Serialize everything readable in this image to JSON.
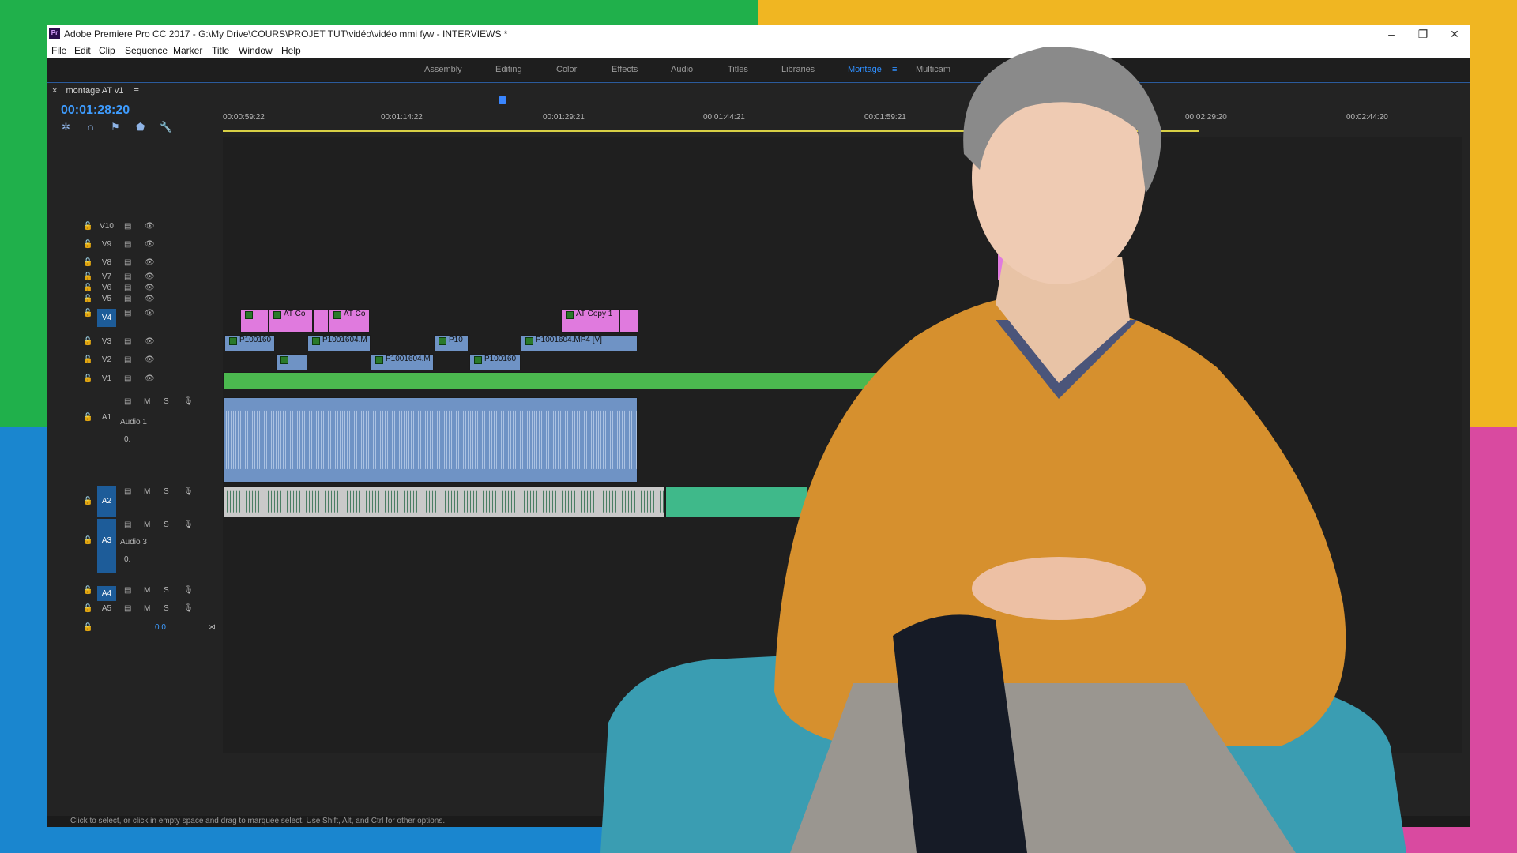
{
  "colors": {
    "quad_tl": "#20b04b",
    "quad_tr": "#f0b622",
    "quad_bl": "#1a86cf",
    "quad_br": "#d94aa0",
    "accent": "#2f8fff"
  },
  "window": {
    "title": "Adobe Premiere Pro CC 2017 - G:\\My Drive\\COURS\\PROJET TUT\\vidéo\\vidéo mmi fyw - INTERVIEWS *",
    "app_icon": "Pr",
    "controls": {
      "minimize": "–",
      "restore": "❐",
      "close": "✕"
    }
  },
  "menu": [
    "File",
    "Edit",
    "Clip",
    "Sequence",
    "Marker",
    "Title",
    "Window",
    "Help"
  ],
  "workspaces": {
    "items": [
      "Assembly",
      "Editing",
      "Color",
      "Effects",
      "Audio",
      "Titles",
      "Libraries",
      "Montage",
      "Multicam"
    ],
    "active": "Montage",
    "menu_icon": "≡"
  },
  "sequence": {
    "tab_close": "×",
    "tab_label": "montage AT v1",
    "tab_menu": "≡",
    "timecode": "00:01:28:20"
  },
  "ruler": {
    "labels": [
      "00:00:59:22",
      "00:01:14:22",
      "00:01:29:21",
      "00:01:44:21",
      "00:01:59:21",
      "00:02:29:20",
      "00:02:44:20"
    ]
  },
  "tracks": {
    "video": [
      "V10",
      "V9",
      "V8",
      "V7",
      "V6",
      "V5",
      "V4",
      "V3",
      "V2",
      "V1"
    ],
    "audio": [
      {
        "id": "A1",
        "name": "Audio 1",
        "vol": "0."
      },
      {
        "id": "A2",
        "name": "",
        "vol": ""
      },
      {
        "id": "A3",
        "name": "Audio 3",
        "vol": "0."
      },
      {
        "id": "A4",
        "name": "",
        "vol": ""
      },
      {
        "id": "A5",
        "name": "",
        "vol": ""
      }
    ],
    "master_value": "0.0",
    "m_label": "M",
    "s_label": "S"
  },
  "clips": {
    "v4": [
      "AT Co",
      "AT Co",
      "AT Copy 1"
    ],
    "v3": [
      "P100160",
      "P1001604.M",
      "P10",
      "P1001604.MP4 [V]"
    ],
    "v2": [
      "P1001604.M",
      "P100160"
    ]
  },
  "status": "Click to select, or click in empty space and drag to marquee select. Use Shift, Alt, and Ctrl for other options."
}
